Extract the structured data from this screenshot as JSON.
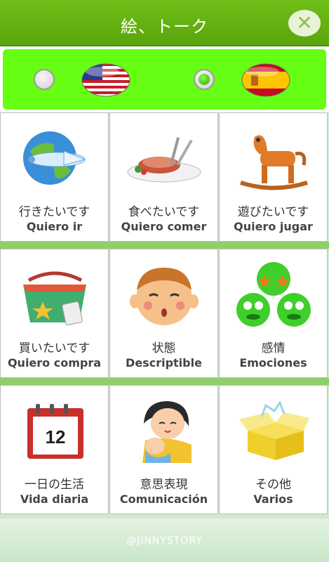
{
  "header": {
    "title": "絵、トーク",
    "close_label": "✕"
  },
  "languages": [
    {
      "name": "English",
      "flag": "us-flag-icon",
      "selected": false
    },
    {
      "name": "Spanish",
      "flag": "spain-flag-icon",
      "selected": true
    }
  ],
  "categories": [
    {
      "ja": "行きたいです",
      "es": "Quiero ir",
      "icon": "airplane-globe-icon"
    },
    {
      "ja": "食べたいです",
      "es": "Quiero comer",
      "icon": "food-plate-icon"
    },
    {
      "ja": "遊びたいです",
      "es": "Quiero jugar",
      "icon": "rocking-horse-icon"
    },
    {
      "ja": "買いたいです",
      "es": "Quiero compra",
      "icon": "shopping-bag-icon"
    },
    {
      "ja": "状態",
      "es": "Descriptible",
      "icon": "face-icon"
    },
    {
      "ja": "感情",
      "es": "Emociones",
      "icon": "emoticons-icon"
    },
    {
      "ja": "一日の生活",
      "es": "Vida diaria",
      "icon": "calendar-icon",
      "calendar_day": "12"
    },
    {
      "ja": "意思表現",
      "es": "Comunicación",
      "icon": "mother-baby-icon"
    },
    {
      "ja": "その他",
      "es": "Varios",
      "icon": "open-box-icon"
    }
  ],
  "footer": {
    "credit": "@JINNYSTORY"
  },
  "colors": {
    "titlebar": "#5aa50c",
    "langbar": "#66ff14",
    "separator": "#8fcf6a"
  }
}
